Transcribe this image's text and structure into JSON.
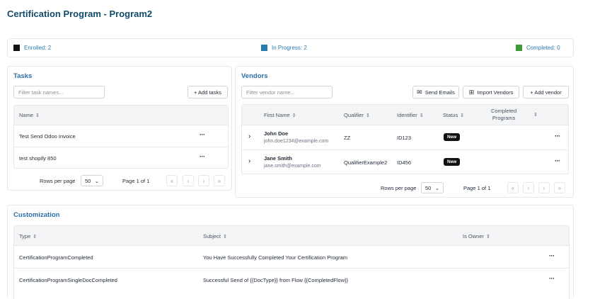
{
  "page": {
    "title": "Certification Program - Program2"
  },
  "status": {
    "enrolled": {
      "label": "Enrolled: 2",
      "color": "#111111"
    },
    "in_progress": {
      "label": "In Progress: 2",
      "color": "#2a7bb0"
    },
    "completed": {
      "label": "Completed: 0",
      "color": "#3a9a3a"
    }
  },
  "tasks": {
    "title": "Tasks",
    "filter_placeholder": "Filter task names...",
    "add_label": "+ Add tasks",
    "columns": [
      "Name"
    ],
    "rows": [
      {
        "name": "Test Send Odoo Invoice"
      },
      {
        "name": "test shopify 850"
      }
    ],
    "pager": {
      "rows_per_page_label": "Rows per page",
      "rows_per_page": "50",
      "page_info": "Page 1 of 1"
    }
  },
  "vendors": {
    "title": "Vendors",
    "filter_placeholder": "Filter vendor name...",
    "send_emails_label": "Send Emails",
    "import_label": "Import Vendors",
    "add_label": "+ Add vendor",
    "columns": {
      "first_name": "First Name",
      "qualifier": "Qualifier",
      "identifier": "Identifier",
      "status": "Status",
      "completed_line1": "Completed",
      "completed_line2": "Programs"
    },
    "rows": [
      {
        "name": "John Doe",
        "email": "john.doe1234@example.com",
        "qualifier": "ZZ",
        "identifier": "ID123",
        "status": "New"
      },
      {
        "name": "Jane Smith",
        "email": "jane.smith@example.com",
        "qualifier": "QualifierExample2",
        "identifier": "ID456",
        "status": "New"
      }
    ],
    "pager": {
      "rows_per_page_label": "Rows per page",
      "rows_per_page": "50",
      "page_info": "Page 1 of 1"
    }
  },
  "customization": {
    "title": "Customization",
    "columns": {
      "type": "Type",
      "subject": "Subject",
      "is_owner": "Is Owner"
    },
    "rows": [
      {
        "type": "CertificationProgramCompleted",
        "subject": "You Have Successfully Completed Your Certification Program"
      },
      {
        "type": "CertificationProgramSingleDocCompleted",
        "subject": "Successful Send of {{DocType}} from Flow {{CompletedFlow}}"
      }
    ]
  },
  "icons": {
    "sort": "sort-arrows-icon",
    "more": "more-dots-icon",
    "expand": "chevron-right-icon",
    "mail": "mail-icon",
    "import": "import-icon"
  }
}
